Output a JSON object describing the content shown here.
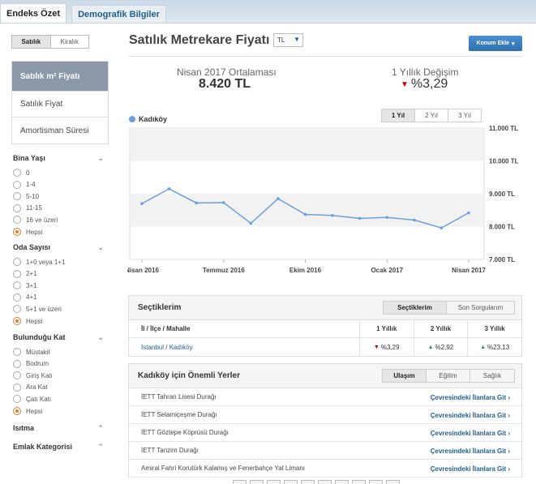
{
  "tabs": [
    {
      "label": "Endeks Özet",
      "active": true
    },
    {
      "label": "Demografik Bilgiler",
      "active": false
    }
  ],
  "sidebar": {
    "listing_type": {
      "options": [
        "Satılık",
        "Kiralık"
      ],
      "selected": "Satılık"
    },
    "menu": [
      {
        "label": "Satılık m² Fiyatı",
        "selected": true
      },
      {
        "label": "Satılık Fiyat",
        "selected": false
      },
      {
        "label": "Amortisman Süresi",
        "selected": false
      }
    ],
    "filters": [
      {
        "title": "Bina Yaşı",
        "options": [
          "0",
          "1-4",
          "5-10",
          "11-15",
          "16 ve üzeri",
          "Hepsi"
        ],
        "selected": "Hepsi"
      },
      {
        "title": "Oda Sayısı",
        "options": [
          "1+0 veya 1+1",
          "2+1",
          "3+1",
          "4+1",
          "5+1 ve üzeri",
          "Hepsi"
        ],
        "selected": "Hepsi"
      },
      {
        "title": "Bulunduğu Kat",
        "options": [
          "Müstakil",
          "Bodrum",
          "Giriş Katı",
          "Ara Kat",
          "Çatı Katı",
          "Hepsi"
        ],
        "selected": "Hepsi"
      }
    ],
    "collapsed": [
      "Isıtma",
      "Emlak Kategorisi"
    ]
  },
  "header": {
    "title": "Satılık Metrekare Fiyatı",
    "currency": "TL",
    "add_button": "Konum Ekle"
  },
  "stats": {
    "avg_label": "Nisan 2017 Ortalaması",
    "avg_value": "8.420 TL",
    "change_label": "1 Yıllık Değişim",
    "change_value": "%3,29"
  },
  "range_tabs": {
    "options": [
      "1 Yıl",
      "2 Yıl",
      "3 Yıl"
    ],
    "selected": "1 Yıl"
  },
  "chart_data": {
    "type": "line",
    "series": [
      {
        "name": "Kadıköy",
        "values": [
          8700,
          9150,
          8720,
          8730,
          8100,
          8850,
          8370,
          8340,
          8250,
          8280,
          8200,
          7960,
          8420
        ]
      }
    ],
    "x_tick_labels": [
      "Nisan 2016",
      "Temmuz 2016",
      "Ekim 2016",
      "Ocak 2017",
      "Nisan 2017"
    ],
    "y_tick_labels": [
      "7.000 TL",
      "8.000 TL",
      "9.000 TL",
      "10.000 TL",
      "11.000 TL"
    ],
    "ylim": [
      7000,
      11000
    ],
    "color": "#6aa0dd"
  },
  "selections": {
    "title": "Seçtiklerim",
    "tabs": [
      "Seçtiklerim",
      "Son Sorgularım"
    ],
    "columns": [
      "İl / İlçe / Mahalle",
      "1 Yıllık",
      "2 Yıllık",
      "3 Yıllık"
    ],
    "rows": [
      {
        "il": "İstanbul",
        "sep": " / ",
        "ilce": "Kadıköy",
        "y1": "%3,29",
        "y2": "%2,92",
        "y3": "%23,13"
      }
    ]
  },
  "places": {
    "title": "Kadıköy için Önemli Yerler",
    "tabs": [
      "Ulaşım",
      "Eğitim",
      "Sağlık"
    ],
    "link_label": "Çevresindeki İlanlara Git",
    "items": [
      "İETT Tahran Lisesi Durağı",
      "İETT Selamiçeşme Durağı",
      "İETT Göztepe Köprüsü Durağı",
      "İETT Tanzim Durağı",
      "Amiral Fahri Korutürk Kalamış ve Fenerbahçe Yat Limanı"
    ]
  }
}
